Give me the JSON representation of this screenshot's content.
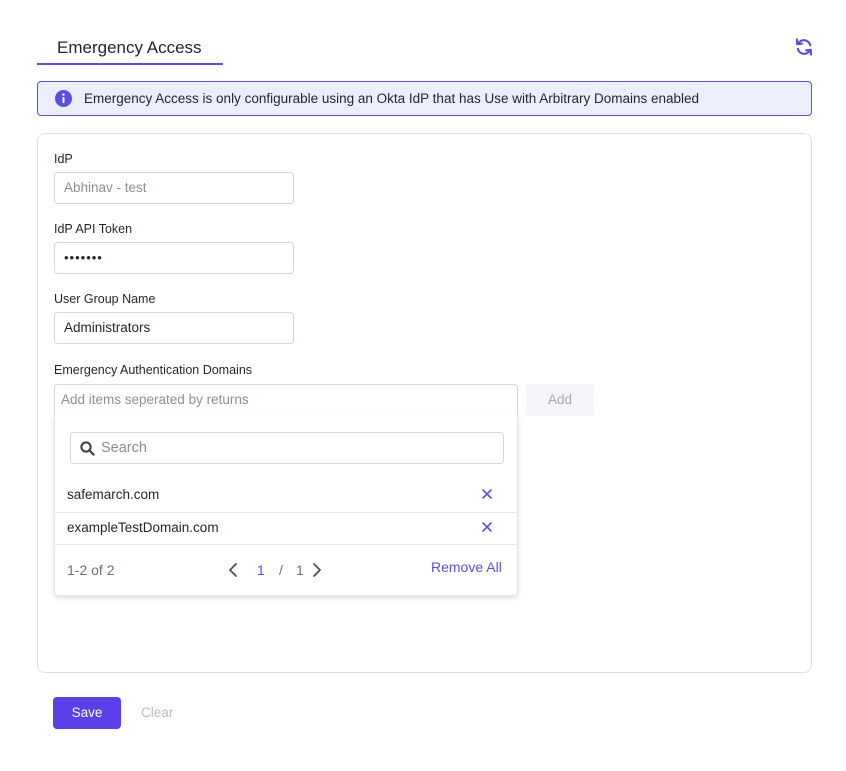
{
  "header": {
    "tab_label": "Emergency Access",
    "refresh_icon": "refresh-icon"
  },
  "banner": {
    "icon": "info-icon",
    "text": "Emergency Access is only configurable using an Okta IdP that has Use with Arbitrary Domains enabled"
  },
  "form": {
    "idp": {
      "label": "IdP",
      "placeholder": "Abhinav - test"
    },
    "api_token": {
      "label": "IdP API Token",
      "value": "•••••••"
    },
    "group": {
      "label": "User Group Name",
      "value": "Administrators"
    },
    "domains": {
      "label": "Emergency Authentication Domains",
      "placeholder": "Add items seperated by returns",
      "add_label": "Add",
      "search_placeholder": "Search",
      "items": [
        "safemarch.com",
        "exampleTestDomain.com"
      ],
      "count_text": "1-2 of 2",
      "page_current": "1",
      "page_separator": "/",
      "page_total": "1",
      "remove_all_label": "Remove All"
    }
  },
  "actions": {
    "save_label": "Save",
    "clear_label": "Clear"
  },
  "colors": {
    "accent": "#5b4fe0",
    "primary_button": "#5b3fe8",
    "banner_bg": "#eceffb"
  }
}
